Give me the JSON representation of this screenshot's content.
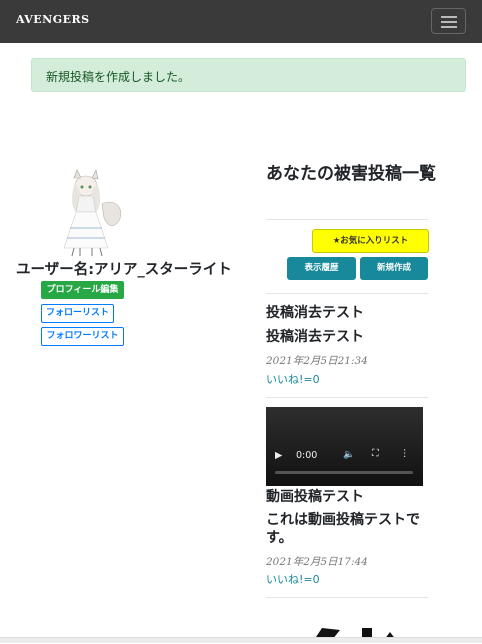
{
  "navbar": {
    "brand": "AVENGERS",
    "menu_icon": "hamburger-menu-icon"
  },
  "alert": {
    "text": "新規投稿を作成しました。",
    "color": "#d4edda"
  },
  "profile": {
    "avatar_icon": "character-avatar",
    "username_label": "ユーザー名:アリア_スターライト",
    "edit_button": "プロフィール編集",
    "follow_list_button": "フォローリスト",
    "follower_list_button": "フォロワーリスト"
  },
  "main": {
    "title": "あなたの被害投稿一覧",
    "favorites_button": "★お気に入りリスト",
    "history_button": "表示履歴",
    "new_post_button": "新規作成",
    "posts": [
      {
        "title": "投稿消去テスト",
        "body": "投稿消去テスト",
        "date": "2021年2月5日21:34",
        "likes": "いいね!=0"
      },
      {
        "title": "動画投稿テスト",
        "body": "これは動画投稿テストです。",
        "date": "2021年2月5日17:44",
        "likes": "いいね!=0",
        "video_time": "0:00"
      }
    ]
  },
  "colors": {
    "navbar": "#3a3a3a",
    "teal": "#17899a",
    "yellow": "#ffff00",
    "green": "#28a745",
    "link": "#007bff"
  }
}
